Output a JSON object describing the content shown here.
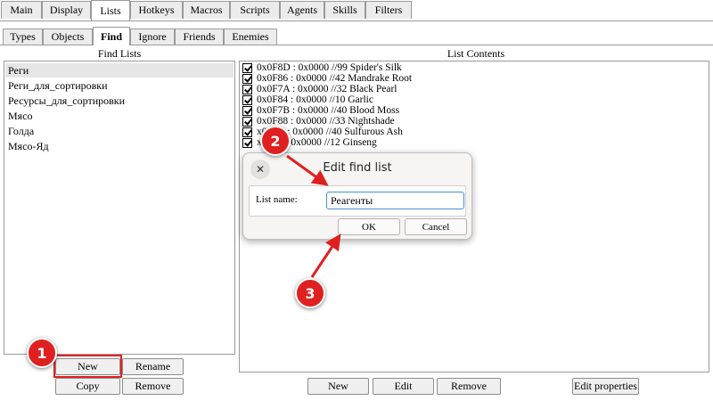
{
  "top_tabs": [
    "Main",
    "Display",
    "Lists",
    "Hotkeys",
    "Macros",
    "Scripts",
    "Agents",
    "Skills",
    "Filters"
  ],
  "sub_tabs": [
    "Types",
    "Objects",
    "Find",
    "Ignore",
    "Friends",
    "Enemies"
  ],
  "find_lists": {
    "header": "Find Lists",
    "items": [
      "Реги",
      "Реги_для_сортировки",
      "Ресурсы_для_сортировки",
      "Мясо",
      "Голда",
      "Мясо-Яд"
    ]
  },
  "left_buttons": {
    "new": "New",
    "rename": "Rename",
    "copy": "Copy",
    "remove": "Remove"
  },
  "list_contents": {
    "header": "List Contents",
    "rows": [
      "0x0F8D : 0x0000 //99 Spider's Silk",
      "0x0F86 : 0x0000 //42 Mandrake Root",
      "0x0F7A : 0x0000 //32 Black Pearl",
      "0x0F84 : 0x0000 //10 Garlic",
      "0x0F7B : 0x0000 //40 Blood Moss",
      "0x0F88 : 0x0000 //33 Nightshade",
      "x0F8C : 0x0000 //40 Sulfurous Ash",
      "x0F85 : 0x0000 //12 Ginseng"
    ]
  },
  "right_buttons": {
    "new": "New",
    "edit": "Edit",
    "remove": "Remove",
    "properties": "Edit properties"
  },
  "dialog": {
    "title": "Edit find list",
    "close": "✕",
    "label": "List name:",
    "value": "Реагенты",
    "ok": "OK",
    "cancel": "Cancel"
  },
  "annotations": [
    "1",
    "2",
    "3"
  ],
  "colors": {
    "accent": "#e02020",
    "focus": "#4a90d9"
  }
}
